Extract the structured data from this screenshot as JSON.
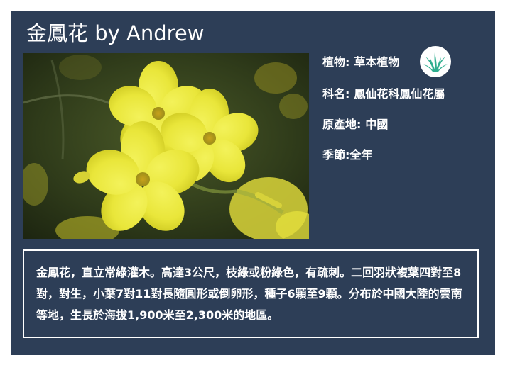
{
  "card": {
    "title": "金鳳花 by Andrew",
    "image_alt": "yellow flowers photo",
    "info": {
      "plant": {
        "label": "植物:",
        "value": "草本植物",
        "icon": "grass-icon"
      },
      "family": {
        "label": "科名:",
        "value": "鳳仙花科鳳仙花屬"
      },
      "origin": {
        "label": "原產地:",
        "value": "中國"
      },
      "season": {
        "label": "季節:",
        "value": "全年"
      }
    },
    "description": "金鳳花，直立常綠灌木。高達3公尺，枝綠或粉綠色，有疏刺。二回羽狀複葉四對至8對，對生，小葉7對11對長隨圓形或倒卵形，種子6顆至9顆。分布於中國大陸的雲南等地，生長於海拔1,900米至2,300米的地區。"
  },
  "colors": {
    "card_background": "#2d3e57",
    "text": "#ffffff",
    "icon_grass": "#2fae8f"
  }
}
